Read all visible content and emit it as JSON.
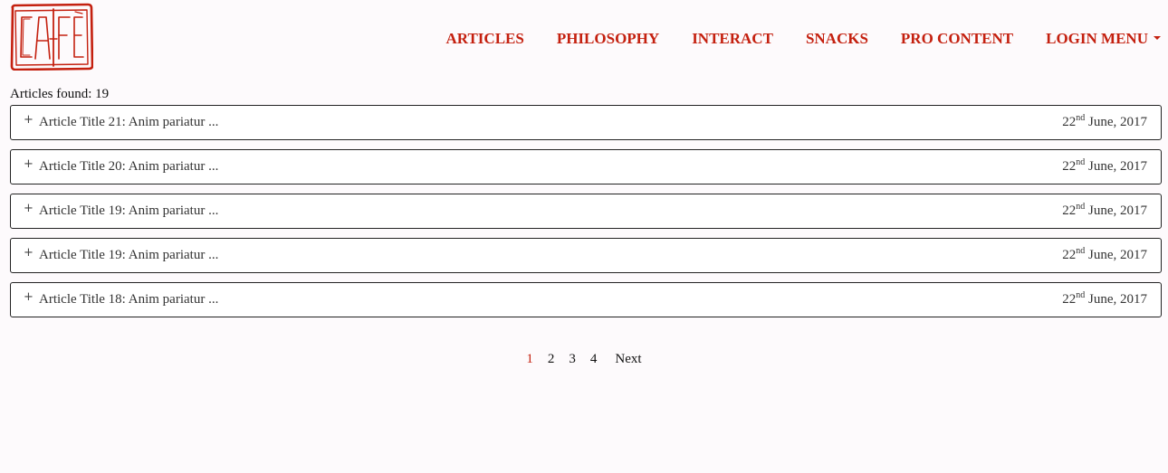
{
  "logo": {
    "text": "CAFE",
    "color": "#c4200f"
  },
  "nav": {
    "items": [
      "ARTICLES",
      "PHILOSOPHY",
      "INTERACT",
      "SNACKS",
      "PRO CONTENT"
    ],
    "login_label": "LOGIN MENU"
  },
  "results": {
    "found_text": "Articles found: 19"
  },
  "articles": [
    {
      "title": "Article Title 21: Anim pariatur ...",
      "day": "22",
      "suffix": "nd",
      "rest": " June, 2017"
    },
    {
      "title": "Article Title 20: Anim pariatur ...",
      "day": "22",
      "suffix": "nd",
      "rest": " June, 2017"
    },
    {
      "title": "Article Title 19: Anim pariatur ...",
      "day": "22",
      "suffix": "nd",
      "rest": " June, 2017"
    },
    {
      "title": "Article Title 19: Anim pariatur ...",
      "day": "22",
      "suffix": "nd",
      "rest": " June, 2017"
    },
    {
      "title": "Article Title 18: Anim pariatur ...",
      "day": "22",
      "suffix": "nd",
      "rest": " June, 2017"
    }
  ],
  "expand_symbol": "+",
  "pagination": {
    "pages": [
      "1",
      "2",
      "3",
      "4"
    ],
    "current": "1",
    "next_label": "Next"
  },
  "colors": {
    "accent": "#c4200f",
    "background": "#fdfafc"
  }
}
